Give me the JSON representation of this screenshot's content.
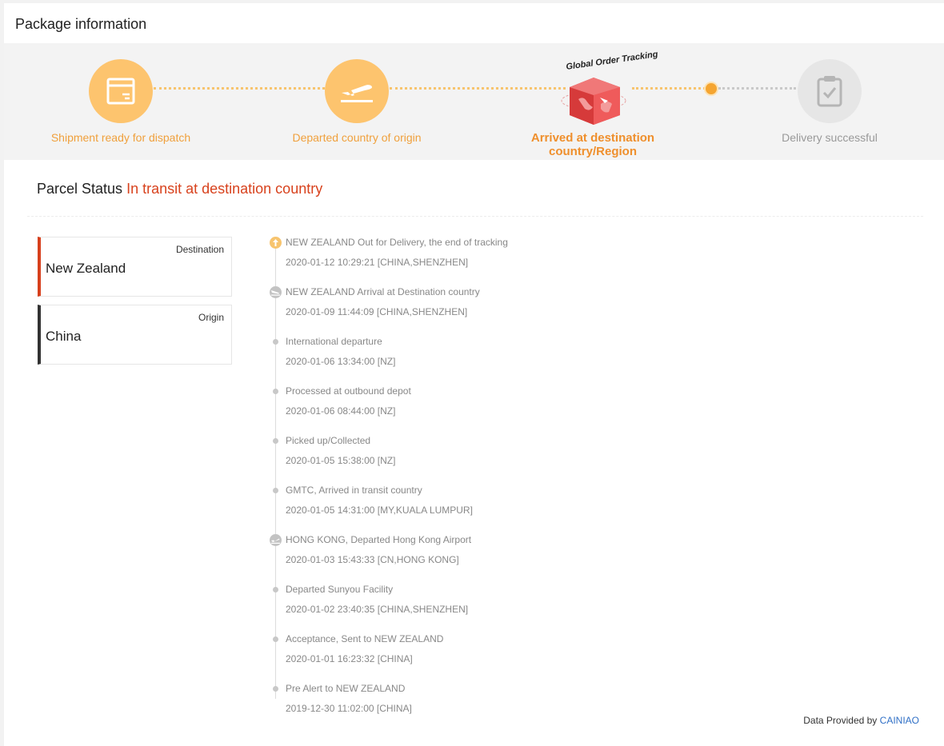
{
  "header": {
    "title": "Package information"
  },
  "progress": {
    "steps": [
      {
        "label": "Shipment ready for dispatch",
        "icon": "package-icon",
        "state": "done"
      },
      {
        "label": "Departed country of origin",
        "icon": "plane-departure-icon",
        "state": "done"
      },
      {
        "label": "Arrived at destination country/Region",
        "icon": "global-order-tracking-cube",
        "state": "current"
      },
      {
        "label": "Delivery successful",
        "icon": "clipboard-check-icon",
        "state": "pending"
      }
    ],
    "badge_text": "Global Order Tracking"
  },
  "status": {
    "label": "Parcel Status",
    "value": "In transit at destination country"
  },
  "locations": {
    "destination": {
      "tag": "Destination",
      "name": "New Zealand"
    },
    "origin": {
      "tag": "Origin",
      "name": "China"
    }
  },
  "timeline": [
    {
      "desc": "NEW ZEALAND Out for Delivery, the end of tracking",
      "time": "2020-01-12 10:29:21 [CHINA,SHENZHEN]",
      "marker": "arrow-up-icon"
    },
    {
      "desc": "NEW ZEALAND Arrival at Destination country",
      "time": "2020-01-09 11:44:09 [CHINA,SHENZHEN]",
      "marker": "plane-arrival-icon"
    },
    {
      "desc": "International departure",
      "time": "2020-01-06 13:34:00 [NZ]",
      "marker": "dot"
    },
    {
      "desc": "Processed at outbound depot",
      "time": "2020-01-06 08:44:00 [NZ]",
      "marker": "dot"
    },
    {
      "desc": "Picked up/Collected",
      "time": "2020-01-05 15:38:00 [NZ]",
      "marker": "dot"
    },
    {
      "desc": "GMTC, Arrived in transit country",
      "time": "2020-01-05 14:31:00 [MY,KUALA LUMPUR]",
      "marker": "dot"
    },
    {
      "desc": "HONG KONG, Departed Hong Kong Airport",
      "time": "2020-01-03 15:43:33 [CN,HONG KONG]",
      "marker": "plane-departure-icon"
    },
    {
      "desc": "Departed Sunyou Facility",
      "time": "2020-01-02 23:40:35 [CHINA,SHENZHEN]",
      "marker": "dot"
    },
    {
      "desc": "Acceptance, Sent to NEW ZEALAND",
      "time": "2020-01-01 16:23:32 [CHINA]",
      "marker": "dot"
    },
    {
      "desc": "Pre Alert to NEW ZEALAND",
      "time": "2019-12-30 11:02:00 [CHINA]",
      "marker": "dot"
    }
  ],
  "footer": {
    "prefix": "Data Provided by",
    "provider": "CAINIAO"
  },
  "colors": {
    "accent": "#fdc46e",
    "status": "#d8421d",
    "link": "#2f6fc6"
  }
}
